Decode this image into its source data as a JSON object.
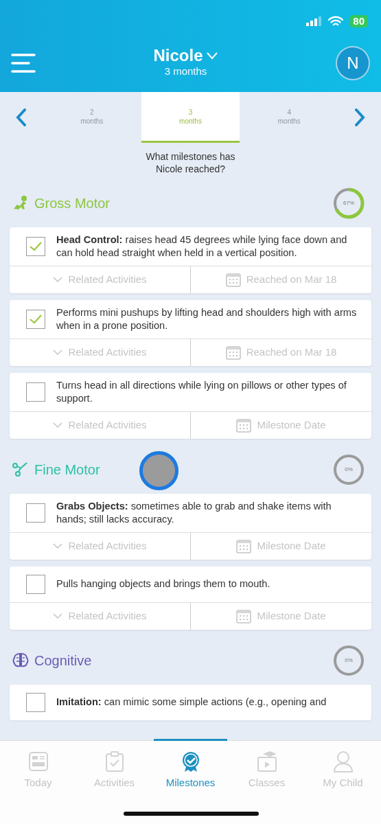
{
  "status_bar": {
    "battery": "80"
  },
  "header": {
    "child_name": "Nicole",
    "age": "3 months",
    "avatar": "N"
  },
  "month_tabs": [
    {
      "number": "2",
      "unit": "months",
      "selected": false
    },
    {
      "number": "3",
      "unit": "months",
      "selected": true
    },
    {
      "number": "4",
      "unit": "months",
      "selected": false
    }
  ],
  "question": "What milestones has Nicole reached?",
  "sections": [
    {
      "kind": "gross",
      "title": "Gross Motor",
      "color": "#8dc63f",
      "level": 0.67,
      "percent": "67%",
      "milestones": [
        {
          "text": "**Head Control:** raises head 45 degrees while lying face down and can hold head straight when held in a vertical position.",
          "checked": true,
          "related": "Related Activities",
          "date": "Reached on Mar 18"
        },
        {
          "text": "Performs mini pushups by lifting head and shoulders high with arms when in a prone position.",
          "checked": true,
          "related": "Related Activities",
          "date": "Reached on Mar 18"
        },
        {
          "text": "Turns head in all directions while lying on pillows or other types of support.",
          "checked": false,
          "related": "Related Activities",
          "date": "Milestone Date"
        }
      ]
    },
    {
      "kind": "fine",
      "touch": true,
      "title": "Fine Motor",
      "color": "#2bbfa4",
      "level": 0,
      "percent": "0%",
      "milestones": [
        {
          "text": "**Grabs Objects:** sometimes able to grab and shake items with hands; still lacks accuracy.",
          "checked": false,
          "related": "Related Activities",
          "date": "Milestone Date"
        },
        {
          "text": "Pulls hanging objects and brings them to mouth.",
          "checked": false,
          "related": "Related Activities",
          "date": "Milestone Date"
        }
      ]
    },
    {
      "kind": "cognitive",
      "title": "Cognitive",
      "color": "#6b5bb5",
      "level": 0,
      "percent": "0%",
      "milestones": [
        {
          "text": "**Imitation:** can mimic some simple actions (e.g., opening and",
          "checked": false
        }
      ]
    }
  ],
  "tab_bar": [
    {
      "kind": "today",
      "label": "Today",
      "selected": false
    },
    {
      "kind": "activities",
      "label": "Activities",
      "selected": false
    },
    {
      "kind": "milestones",
      "label": "Milestones",
      "selected": true
    },
    {
      "kind": "classes",
      "label": "Classes",
      "selected": false
    },
    {
      "kind": "child",
      "label": "My Child",
      "selected": false
    }
  ]
}
